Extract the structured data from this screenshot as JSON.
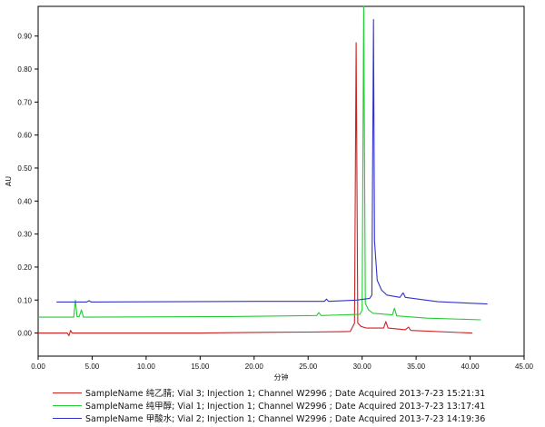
{
  "chart_data": {
    "type": "line",
    "xlabel": "分钟",
    "ylabel": "AU",
    "xlim": [
      0,
      45
    ],
    "ylim": [
      -0.07,
      0.99
    ],
    "x_ticks": [
      "0.00",
      "5.00",
      "10.00",
      "15.00",
      "20.00",
      "25.00",
      "30.00",
      "35.00",
      "40.00",
      "45.00"
    ],
    "y_ticks": [
      "0.00",
      "0.10",
      "0.20",
      "0.30",
      "0.40",
      "0.50",
      "0.60",
      "0.70",
      "0.80",
      "0.90"
    ],
    "grid": false,
    "legend_position": "bottom",
    "series": [
      {
        "name": "SampleName 纯乙腈; Vial 3; Injection 1; Channel W2996 ; Date Acquired 2013-7-23 15:21:31",
        "color": "#cc2222",
        "points": [
          [
            0,
            0.0
          ],
          [
            2.7,
            0.0
          ],
          [
            2.85,
            -0.008
          ],
          [
            3.0,
            0.008
          ],
          [
            3.15,
            0.0
          ],
          [
            15,
            0.0
          ],
          [
            21,
            0.002
          ],
          [
            25,
            0.003
          ],
          [
            28,
            0.004
          ],
          [
            28.9,
            0.005
          ],
          [
            29.3,
            0.03
          ],
          [
            29.45,
            0.88
          ],
          [
            29.6,
            0.03
          ],
          [
            29.9,
            0.02
          ],
          [
            30.4,
            0.015
          ],
          [
            32.0,
            0.015
          ],
          [
            32.2,
            0.035
          ],
          [
            32.4,
            0.015
          ],
          [
            34.0,
            0.01
          ],
          [
            34.3,
            0.018
          ],
          [
            34.5,
            0.008
          ],
          [
            40.2,
            0.0
          ]
        ]
      },
      {
        "name": "SampleName 纯甲醇; Vial 1; Injection 1; Channel W2996 ; Date Acquired 2013-7-23 13:17:41",
        "color": "#22cc33",
        "points": [
          [
            0,
            0.048
          ],
          [
            3.3,
            0.048
          ],
          [
            3.45,
            0.1
          ],
          [
            3.6,
            0.05
          ],
          [
            3.8,
            0.05
          ],
          [
            4.0,
            0.07
          ],
          [
            4.2,
            0.048
          ],
          [
            18,
            0.05
          ],
          [
            25.8,
            0.053
          ],
          [
            26.0,
            0.062
          ],
          [
            26.2,
            0.053
          ],
          [
            29.8,
            0.057
          ],
          [
            30.0,
            0.07
          ],
          [
            30.15,
            0.99
          ],
          [
            30.3,
            0.09
          ],
          [
            30.6,
            0.07
          ],
          [
            31.0,
            0.06
          ],
          [
            32.8,
            0.055
          ],
          [
            33.0,
            0.075
          ],
          [
            33.2,
            0.052
          ],
          [
            36.0,
            0.045
          ],
          [
            41.0,
            0.04
          ]
        ]
      },
      {
        "name": "SampleName 甲酸水; Vial 2; Injection 1; Channel W2996 ; Date Acquired 2013-7-23 14:19:36",
        "color": "#3333cc",
        "points": [
          [
            1.7,
            0.094
          ],
          [
            4.5,
            0.094
          ],
          [
            4.7,
            0.098
          ],
          [
            4.9,
            0.094
          ],
          [
            20,
            0.096
          ],
          [
            26.5,
            0.096
          ],
          [
            26.7,
            0.103
          ],
          [
            26.9,
            0.096
          ],
          [
            29.5,
            0.1
          ],
          [
            30.7,
            0.105
          ],
          [
            30.9,
            0.115
          ],
          [
            31.05,
            0.95
          ],
          [
            31.15,
            0.28
          ],
          [
            31.4,
            0.16
          ],
          [
            31.8,
            0.13
          ],
          [
            32.3,
            0.115
          ],
          [
            33.5,
            0.108
          ],
          [
            33.8,
            0.122
          ],
          [
            34.0,
            0.108
          ],
          [
            37.0,
            0.095
          ],
          [
            41.6,
            0.088
          ]
        ]
      }
    ]
  }
}
